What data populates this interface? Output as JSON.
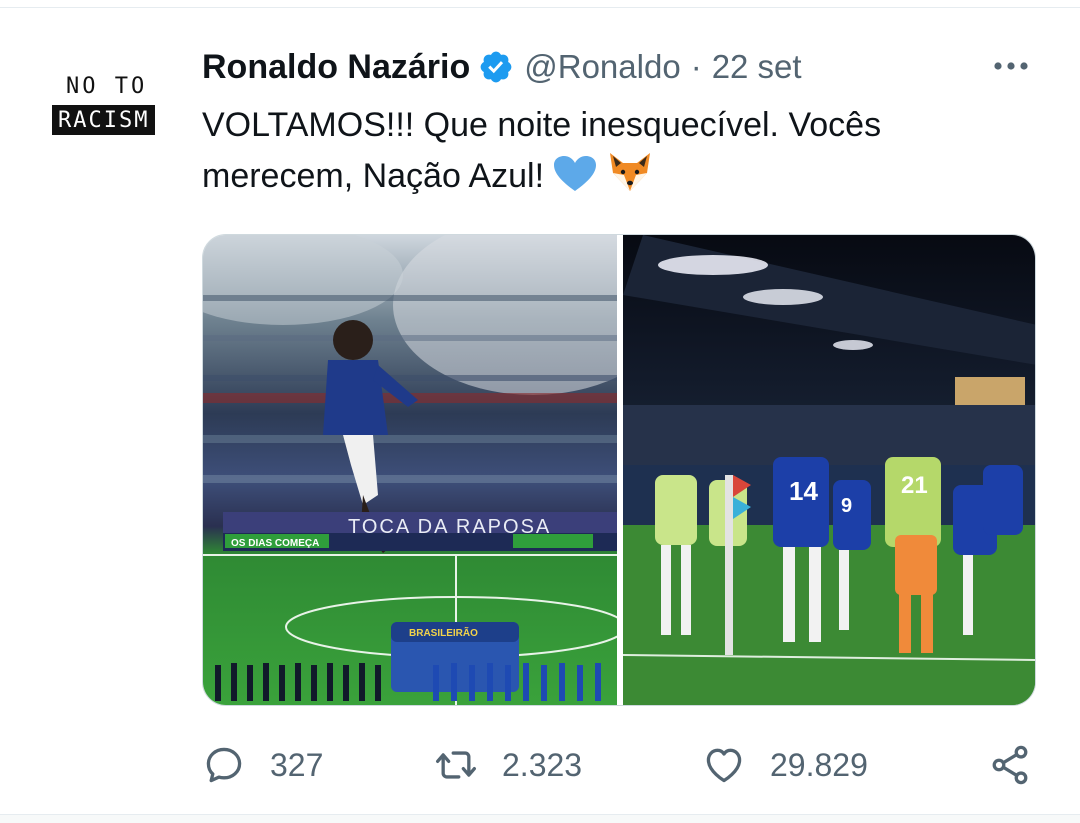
{
  "avatar": {
    "line1": "NO TO",
    "line2": "RACISM"
  },
  "tweet": {
    "display_name": "Ronaldo Nazário",
    "handle": "@Ronaldo",
    "separator": "·",
    "date": "22 set",
    "text": "VOLTAMOS!!! Que noite inesquecível. Vocês merecem, Nação Azul!",
    "emojis": [
      "blue-heart",
      "fox-face"
    ]
  },
  "media": {
    "left_photo": {
      "banner": "TOCA DA RAPOSA",
      "board_text": "BRASILEIRÃO",
      "ad_text": "OS DIAS COMEÇA"
    },
    "right_photo": {
      "shirt_numbers": [
        "14",
        "21",
        "9"
      ]
    }
  },
  "actions": {
    "reply_count": "327",
    "retweet_count": "2.323",
    "like_count": "29.829"
  },
  "colors": {
    "verified": "#1d9bf0",
    "secondary_text": "#536471",
    "primary_text": "#0f1419",
    "heart_emoji": "#5da9e9"
  }
}
